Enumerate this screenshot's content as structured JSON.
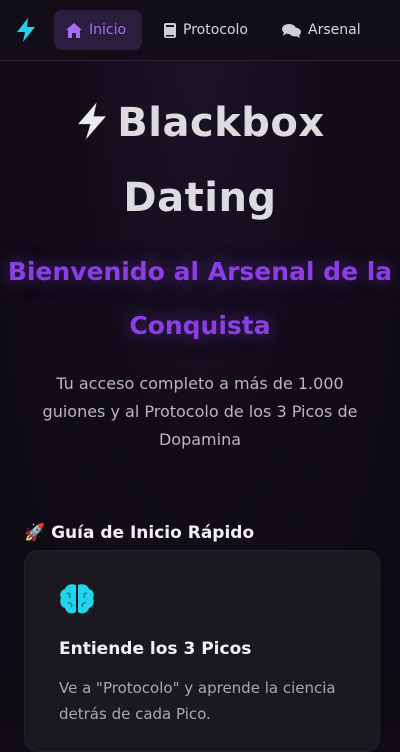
{
  "nav": {
    "items": [
      {
        "label": "Inicio",
        "icon": "home-icon",
        "active": true
      },
      {
        "label": "Protocolo",
        "icon": "book-icon",
        "active": false
      },
      {
        "label": "Arsenal",
        "icon": "chat-icon",
        "active": false
      }
    ]
  },
  "hero": {
    "title_line1": "Blackbox",
    "title_line2": "Dating",
    "subtitle": "Bienvenido al Arsenal de la Conquista",
    "description": "Tu acceso completo a más de 1.000 guiones y al Protocolo de los 3 Picos de Dopamina"
  },
  "quick_start": {
    "title": "🚀 Guía de Inicio Rápido",
    "card": {
      "icon": "brain-icon",
      "title": "Entiende los 3 Picos",
      "text": "Ve a \"Protocolo\" y aprende la ciencia detrás de cada Pico."
    }
  },
  "colors": {
    "accent": "#a76cf5",
    "subtitle": "#8c3ee6",
    "logo": "#22d3ee",
    "brain": "#22d3ee"
  }
}
